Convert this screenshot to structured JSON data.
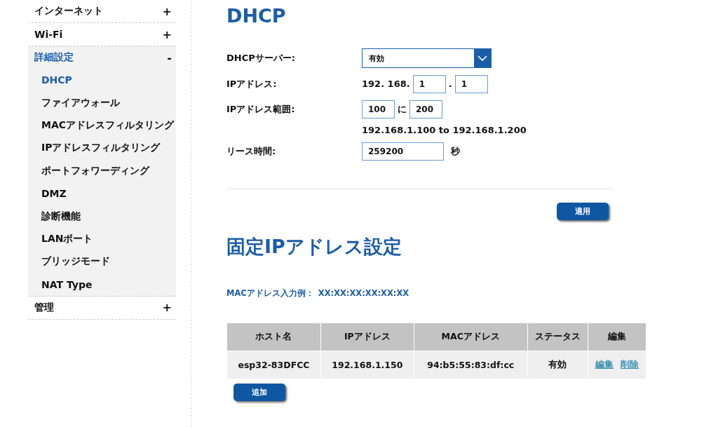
{
  "sidebar": {
    "items": [
      {
        "label": "インターネット",
        "toggle": "+",
        "expanded": false
      },
      {
        "label": "Wi-Fi",
        "toggle": "+",
        "expanded": false
      },
      {
        "label": "詳細設定",
        "toggle": "-",
        "expanded": true,
        "children": [
          {
            "label": "DHCP",
            "selected": true
          },
          {
            "label": "ファイアウォール",
            "selected": false
          },
          {
            "label": "MACアドレスフィルタリング",
            "selected": false
          },
          {
            "label": "IPアドレスフィルタリング",
            "selected": false
          },
          {
            "label": "ポートフォワーディング",
            "selected": false
          },
          {
            "label": "DMZ",
            "selected": false
          },
          {
            "label": "診断機能",
            "selected": false
          },
          {
            "label": "LANポート",
            "selected": false
          },
          {
            "label": "ブリッジモード",
            "selected": false
          },
          {
            "label": "NAT Type",
            "selected": false
          }
        ]
      },
      {
        "label": "管理",
        "toggle": "+",
        "expanded": false
      }
    ]
  },
  "dhcp": {
    "title": "DHCP",
    "server": {
      "label": "DHCPサーバー:",
      "value": "有効"
    },
    "ip": {
      "label": "IPアドレス:",
      "prefix": "192. 168.",
      "octet3": "1",
      "dot": ".",
      "octet4": "1"
    },
    "range": {
      "label": "IPアドレス範囲:",
      "start": "100",
      "joiner": "に",
      "end": "200",
      "summary": "192.168.1.100 to 192.168.1.200"
    },
    "lease": {
      "label": "リース時間:",
      "value": "259200",
      "unit": "秒"
    },
    "apply": "適用"
  },
  "static": {
    "title": "固定IPアドレス設定",
    "hint_label": "MACアドレス入力例：",
    "hint_value": "XX:XX:XX:XX:XX:XX",
    "table": {
      "columns": [
        "ホスト名",
        "IPアドレス",
        "MACアドレス",
        "ステータス",
        "編集"
      ],
      "rows": [
        {
          "host": "esp32-83DFCC",
          "ip": "192.168.1.150",
          "mac": "94:b5:55:83:df:cc",
          "status": "有効",
          "actions": [
            "編集",
            "削除"
          ]
        }
      ]
    },
    "add": "追加"
  }
}
